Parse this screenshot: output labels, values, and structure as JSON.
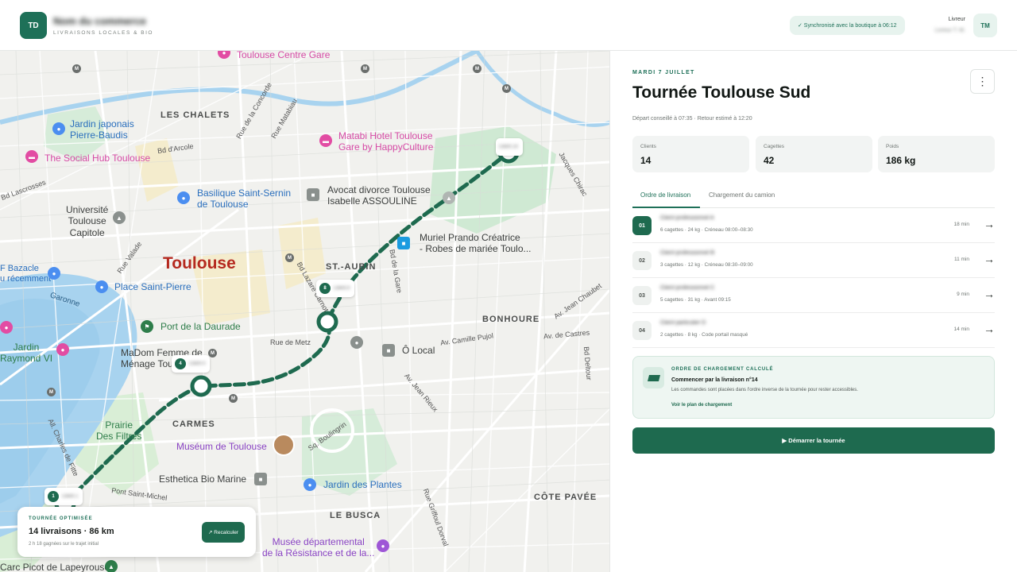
{
  "header": {
    "logo_initials": "TD",
    "brand_name": "Nom du commerce",
    "brand_sub": "LIVRAISONS LOCALES & BIO",
    "sync_status": "✓ Synchronisé avec la boutique à 06:12",
    "user_role": "Livreur",
    "user_name": "Livreur T. M.",
    "avatar_initials": "TM"
  },
  "map": {
    "city": "Toulouse",
    "labels": {
      "les_chalets": "LES CHALETS",
      "st_aubin": "ST.-AUBIN",
      "bonhoure": "BONHOURE",
      "carmes": "CARMES",
      "le_busca": "LE BUSCA",
      "cote_pavee": "CÔTE PAVÉE",
      "centre_gare": "Toulouse Centre Gare",
      "jardin_japonais": "Jardin japonais\nPierre-Baudis",
      "social_hub": "The Social Hub Toulouse",
      "matabi": "Matabi Hotel Toulouse\nGare by HappyCulture",
      "universite": "Université\nToulouse\nCapitole",
      "basilique": "Basilique Saint-Sernin\nde Toulouse",
      "avocat": "Avocat divorce Toulouse\nIsabelle ASSOULINE",
      "muriel": "Muriel Prando Créatrice\n- Robes de mariée Toulo...",
      "bazacle": "F Bazacle\nu récemment",
      "place_st_pierre": "Place Saint-Pierre",
      "garonne": "Garonne",
      "port_daurade": "Port de la Daurade",
      "jardin_raymond": "Jardin\nRaymond VI",
      "madom": "MaDom Femme de\nMénage Toulouse",
      "o_local": "Ô Local",
      "prairie": "Prairie\nDes Filtres",
      "museum": "Muséum de Toulouse",
      "esthetica": "Esthetica Bio Marine",
      "jardin_plantes": "Jardin des Plantes",
      "musee_resistance": "Musée départemental\nde la Résistance et de la...",
      "picot": "Carc Picot de Lapeyrouse",
      "rue_concorde": "Rue de la Concorde",
      "rue_matabiau": "Rue Matabiau",
      "bd_arcole": "Bd d'Arcole",
      "bd_lascrosses": "Bd Lascrosses",
      "rue_valade": "Rue Valade",
      "rue_metz": "Rue de Metz",
      "av_camille": "Av. Camille Pujol",
      "av_castres": "Av. de Castres",
      "av_chaubet": "Av. Jean Chaubet",
      "bd_gare": "Bd de la Gare",
      "bd_lazare": "Bd Lazare Carnot",
      "sq_boulingrin": "Sq. Boulingrin",
      "av_jean_rieux": "Av. Jean Rieux",
      "pont_st_michel": "Pont Saint-Michel",
      "allees_charles": "All. Charles de Fitte",
      "rue_griffoul": "Rue Griffoul Dorval",
      "bd_delrieu": "Bd Deltour",
      "jacques_chirac": "Jacques Chirac"
    },
    "stop_tags": [
      {
        "num": "",
        "text": "Client 14"
      },
      {
        "num": "8",
        "text": "Client 8"
      },
      {
        "num": "4",
        "text": "Client 4"
      },
      {
        "num": "1",
        "text": "Client 1"
      }
    ],
    "route_card": {
      "eyebrow": "TOURNÉE OPTIMISÉE",
      "title": "14 livraisons · 86 km",
      "subtitle": "2 h 18 gagnées sur le trajet initial",
      "button": "↗ Recalculer"
    }
  },
  "panel": {
    "date": "MARDI 7 JUILLET",
    "title": "Tournée Toulouse Sud",
    "menu_icon": "⋮",
    "meta": "Départ conseillé à 07:35 · Retour estimé à 12:20",
    "stats": [
      {
        "label": "Clients",
        "value": "14"
      },
      {
        "label": "Cagettes",
        "value": "42"
      },
      {
        "label": "Poids",
        "value": "186 kg"
      }
    ],
    "tabs": [
      "Ordre de livraison",
      "Chargement du camion"
    ],
    "deliveries": [
      {
        "num": "01",
        "name": "Client professionnel A",
        "details": "6 cagettes · 24 kg · Créneau 08:00–08:30",
        "time": "18 min"
      },
      {
        "num": "02",
        "name": "Client professionnel B",
        "details": "3 cagettes · 12 kg · Créneau 08:30–09:00",
        "time": "11 min"
      },
      {
        "num": "03",
        "name": "Client professionnel C",
        "details": "5 cagettes · 31 kg · Avant 09:15",
        "time": "9 min"
      },
      {
        "num": "04",
        "name": "Client particulier D",
        "details": "2 cagettes · 8 kg · Code portail masqué",
        "time": "14 min"
      }
    ],
    "arrow": "→",
    "load": {
      "eyebrow": "ORDRE DE CHARGEMENT CALCULÉ",
      "title": "Commencer par la livraison n°14",
      "text": "Les commandes sont placées dans l'ordre inverse de la tournée pour rester accessibles.",
      "link": "Voir le plan de chargement"
    },
    "start_button": "▶ Démarrer la tournée"
  },
  "colors": {
    "accent": "#1e7058",
    "route": "#1e6a4f",
    "accent_soft": "#e7f3ee"
  }
}
